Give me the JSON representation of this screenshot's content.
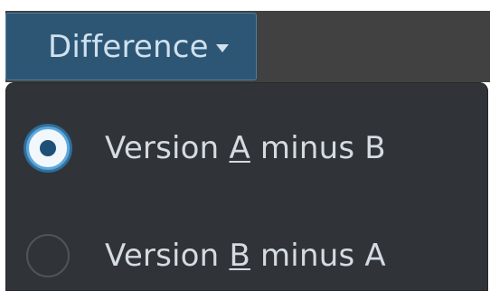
{
  "dropdown": {
    "label": "Difference",
    "icon": "caret-down-icon"
  },
  "menu": {
    "items": [
      {
        "prefix": "Version ",
        "mnemonic": "A",
        "suffix": " minus B",
        "checked": true
      },
      {
        "prefix": "Version ",
        "mnemonic": "B",
        "suffix": " minus A",
        "checked": false
      }
    ]
  },
  "colors": {
    "accent": "#5fa8dd",
    "button_bg": "#2d5675",
    "menu_bg": "#303438",
    "text": "#d4dbe2"
  }
}
